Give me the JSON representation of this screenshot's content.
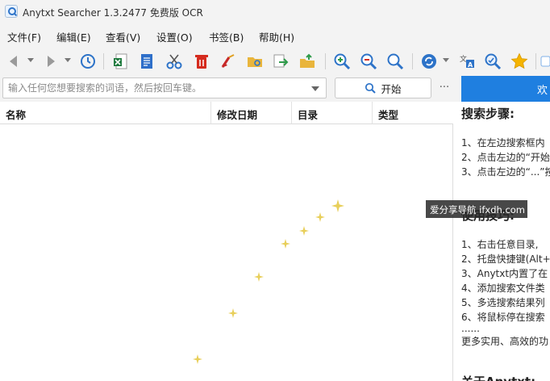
{
  "window": {
    "title": "Anytxt Searcher 1.3.2477 免费版 OCR"
  },
  "menu": [
    "文件(F)",
    "编辑(E)",
    "查看(V)",
    "设置(O)",
    "书签(B)",
    "帮助(H)"
  ],
  "toolbar": {
    "icons": [
      "back-arrow-icon",
      "forward-arrow-icon",
      "history-icon",
      "excel-export-icon",
      "document-icon",
      "cut-icon",
      "delete-icon",
      "clean-icon",
      "open-folder-icon",
      "move-file-icon",
      "copy-to-folder-icon",
      "zoom-in-icon",
      "zoom-out-icon",
      "zoom-reset-icon",
      "refresh-icon",
      "translate-icon",
      "ocr-search-icon",
      "bookmark-star-icon"
    ]
  },
  "search": {
    "placeholder": "输入任何您想要搜索的词语，然后按回车键。",
    "value": "",
    "start_label": "开始",
    "more_label": "...",
    "welcome_tab": "欢"
  },
  "results": {
    "columns": [
      "名称",
      "修改日期",
      "目录",
      "类型"
    ]
  },
  "help_panel": {
    "steps_title": "搜索步骤:",
    "steps": [
      "1、在左边搜索框内",
      "2、点击左边的“开始",
      "3、点击左边的“...”按"
    ],
    "tips_title": "使用技巧:",
    "tips": [
      "1、右击任意目录,",
      "2、托盘快捷键(Alt+",
      "3、Anytxt内置了在",
      "4、添加搜索文件类",
      "5、多选搜索结果列",
      "6、将鼠标停在搜索"
    ],
    "ellipsis": "......",
    "more": "更多实用、高效的功",
    "about_title": "关于Anytxt:"
  },
  "watermark": "爱分享导航 ifxdh.com",
  "colors": {
    "accent": "#1f7fe0",
    "chrome": "#f3f3f3"
  }
}
